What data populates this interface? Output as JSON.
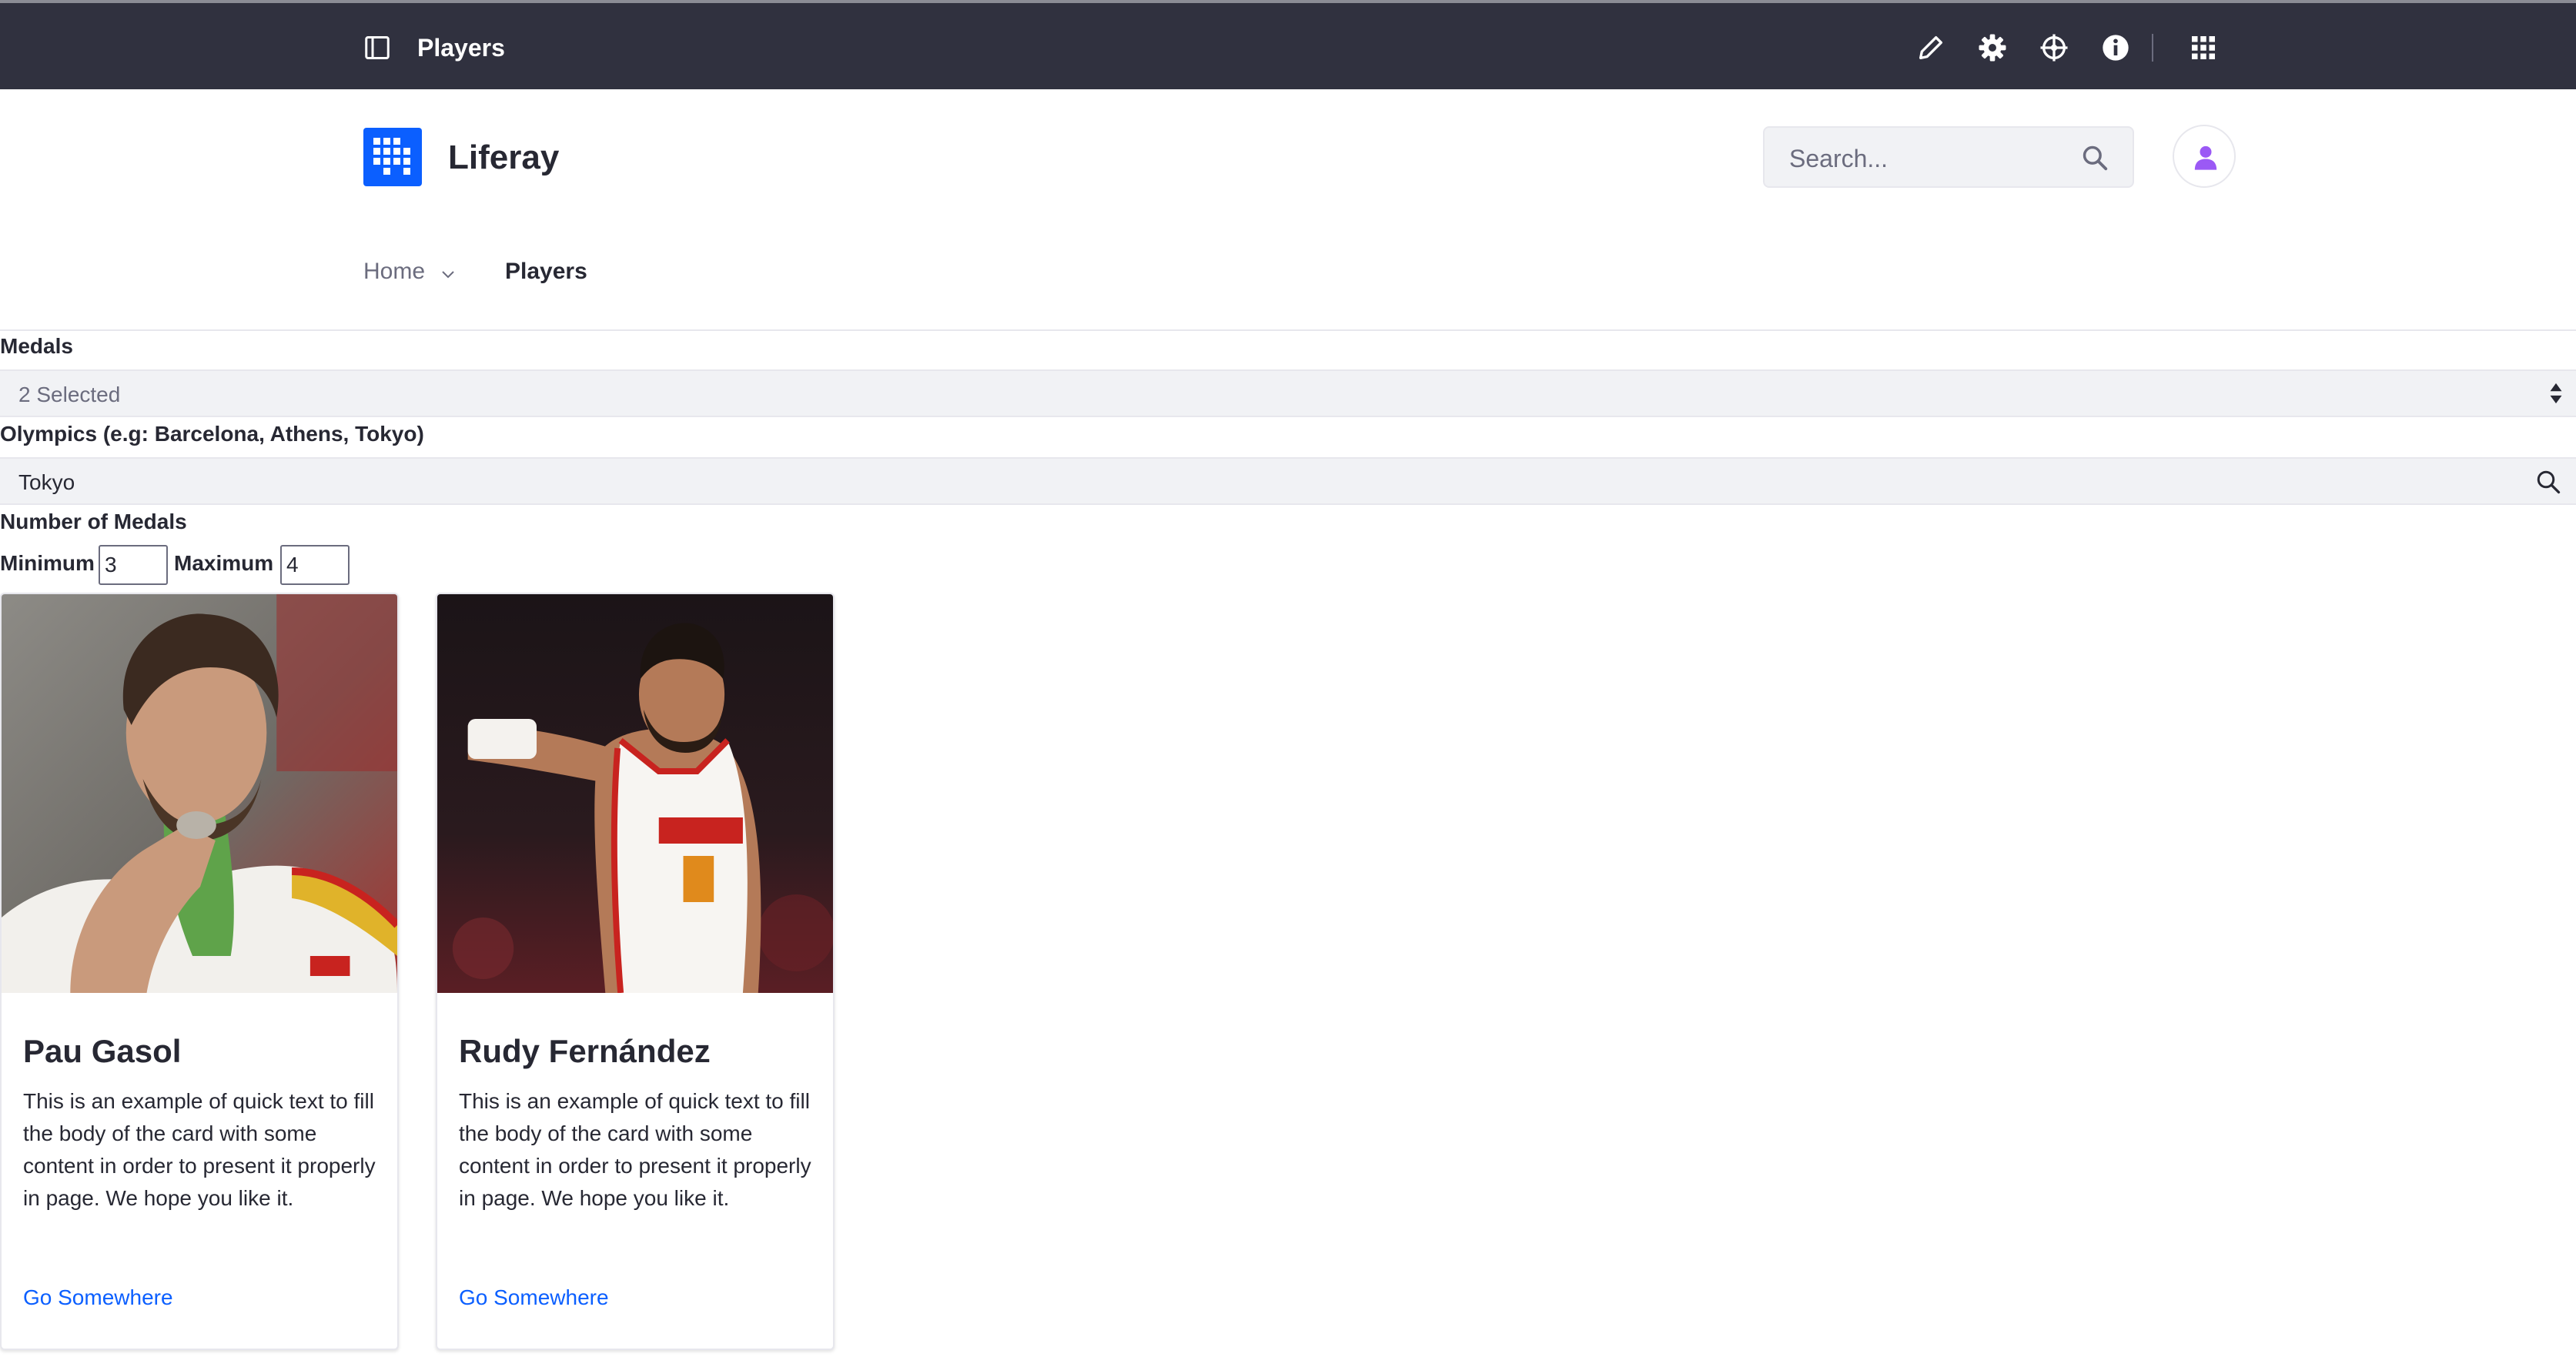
{
  "control_bar": {
    "title": "Players",
    "icons": [
      "sidebar-panel-icon",
      "pencil-icon",
      "gear-icon",
      "simulation-icon",
      "info-icon",
      "apps-grid-icon"
    ]
  },
  "header": {
    "site_name": "Liferay",
    "search": {
      "placeholder": "Search..."
    }
  },
  "nav": {
    "items": [
      "Home",
      "Players"
    ]
  },
  "filters": {
    "medals": {
      "label": "Medals",
      "value": "2 Selected"
    },
    "olympics": {
      "label": "Olympics (e.g: Barcelona, Athens, Tokyo)",
      "value": "Tokyo"
    },
    "number_of_medals": {
      "label": "Number of Medals",
      "minimum_label": "Minimum",
      "minimum_value": "3",
      "maximum_label": "Maximum",
      "maximum_value": "4"
    }
  },
  "cards": [
    {
      "name": "Pau Gasol",
      "body": "This is an example of quick text to fill the body of the card with some content in order to present it properly in page. We hope you like it.",
      "link": "Go Somewhere"
    },
    {
      "name": "Rudy Fernández",
      "body": "This is an example of quick text to fill the body of the card with some content in order to present it properly in page. We hope you like it.",
      "link": "Go Somewhere"
    }
  ],
  "colors": {
    "control_bar": "#30313f",
    "primary": "#0b5fff",
    "avatar_icon": "#9b59f5",
    "text": "#272833"
  }
}
